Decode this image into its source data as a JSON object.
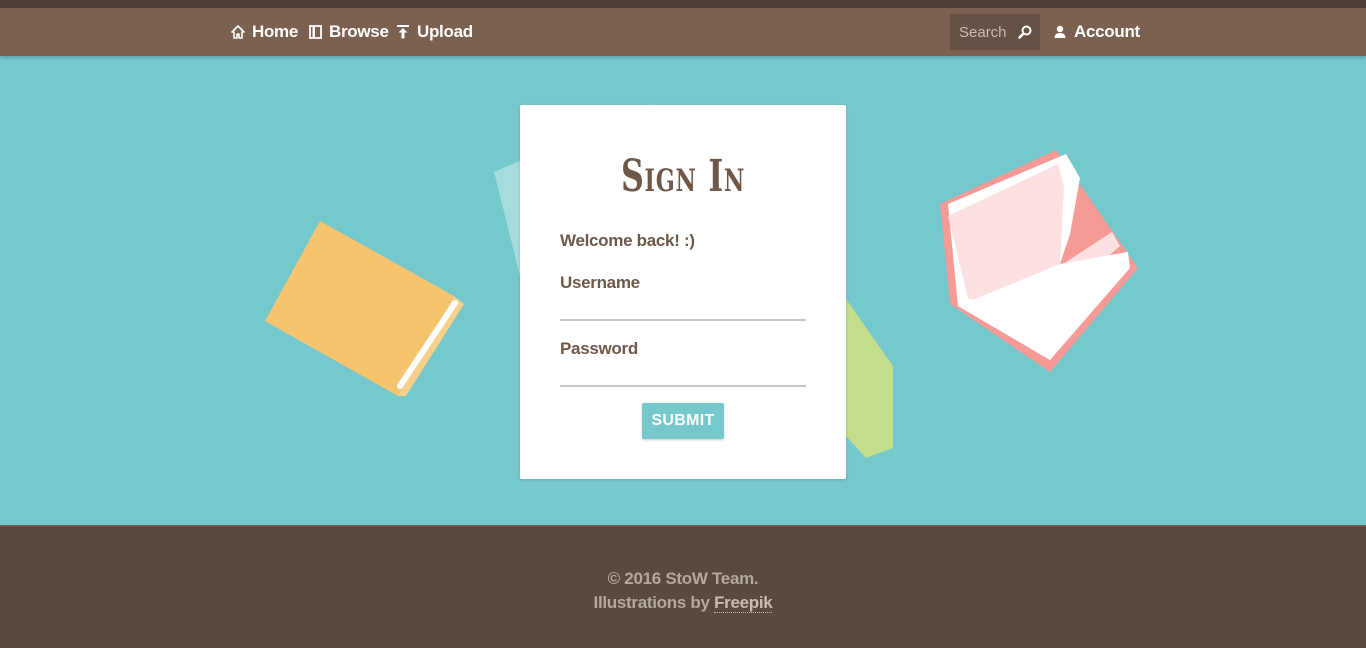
{
  "nav": {
    "home_label": "Home",
    "browse_label": "Browse",
    "upload_label": "Upload",
    "account_label": "Account",
    "search_placeholder": "Search"
  },
  "login": {
    "title": "Sign In",
    "welcome": "Welcome back! :)",
    "username_label": "Username",
    "password_label": "Password",
    "submit_label": "SUBMIT"
  },
  "footer": {
    "copyright": "© 2016 StoW Team.",
    "illustrations_prefix": "Illustrations by ",
    "illustrations_link": "Freepik"
  },
  "colors": {
    "navbar": "#7b6150",
    "hero": "#75c8cc",
    "footer": "#5a4a3e",
    "text": "#6f5848",
    "accent": "#75c8cc"
  }
}
